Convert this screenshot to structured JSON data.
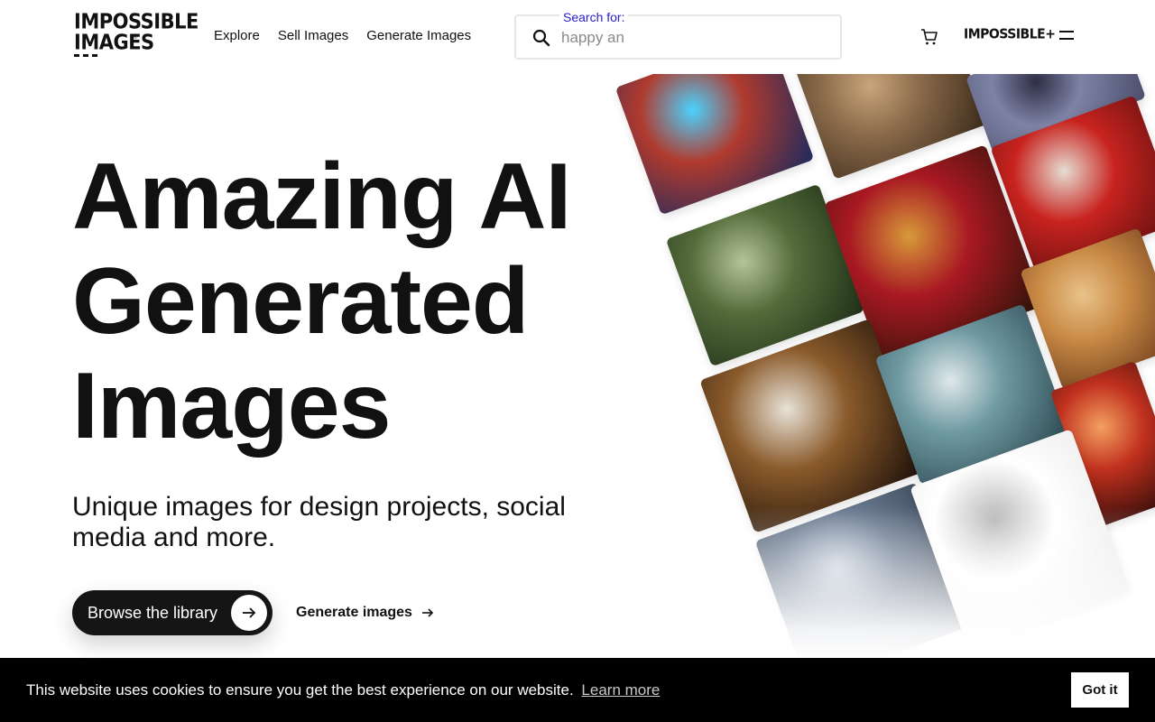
{
  "header": {
    "logo_line1": "IMPOSSIBLE",
    "logo_line2": "IMAGES",
    "logo_reg": "®",
    "nav": [
      "Explore",
      "Sell Images",
      "Generate Images"
    ],
    "search_label": "Search for:",
    "search_placeholder": "happy an",
    "search_icon": "search-icon",
    "cart_icon": "cart-icon",
    "plus_logo": "IMPOSSIBLE+",
    "menu_icon": "menu-icon"
  },
  "hero": {
    "headline_lines": [
      "Amazing AI",
      "Generated",
      "Images"
    ],
    "subtitle": "Unique images for design projects, social media and more.",
    "primary_button": "Browse the library",
    "secondary_button": "Generate images"
  },
  "mosaic": {
    "images": [
      {
        "name": "astronaut-image",
        "colors": [
          "#1d2b5e",
          "#b03a2e",
          "#4ad2ff"
        ]
      },
      {
        "name": "carved-lion-image",
        "colors": [
          "#3a2a1a",
          "#8a6a4a",
          "#c9a57a"
        ]
      },
      {
        "name": "armor-image",
        "colors": [
          "#4b4e6b",
          "#7e83a6",
          "#2e2e44"
        ]
      },
      {
        "name": "santa-dog-image",
        "colors": [
          "#5b0f0f",
          "#c8231f",
          "#e6ddd2"
        ]
      },
      {
        "name": "forest-image",
        "colors": [
          "#203018",
          "#546b3a",
          "#b5c49a"
        ]
      },
      {
        "name": "red-cocktail-image",
        "colors": [
          "#2a1408",
          "#a81822",
          "#d79a3a"
        ]
      },
      {
        "name": "wheat-field-image",
        "colors": [
          "#6b3a1a",
          "#c98a45",
          "#e9c28a"
        ]
      },
      {
        "name": "mince-pie-image",
        "colors": [
          "#1a0f0a",
          "#8a5a2a",
          "#e8e2d8"
        ]
      },
      {
        "name": "mountain-lake-image",
        "colors": [
          "#2e4a52",
          "#6f9aa2",
          "#dfe8ea"
        ]
      },
      {
        "name": "fireworks-image",
        "colors": [
          "#2a0a08",
          "#c0301e",
          "#f4a060"
        ]
      },
      {
        "name": "hotel-image",
        "colors": [
          "#2e3a4a",
          "#6a7a90",
          "#c6d0dc"
        ]
      },
      {
        "name": "rubber-duck-image",
        "colors": [
          "#e6e6e6",
          "#ffffff",
          "#b8b8b8"
        ]
      }
    ]
  },
  "cookie": {
    "message": "This website uses cookies to ensure you get the best experience on our website.",
    "link": "Learn more",
    "button": "Got it"
  }
}
